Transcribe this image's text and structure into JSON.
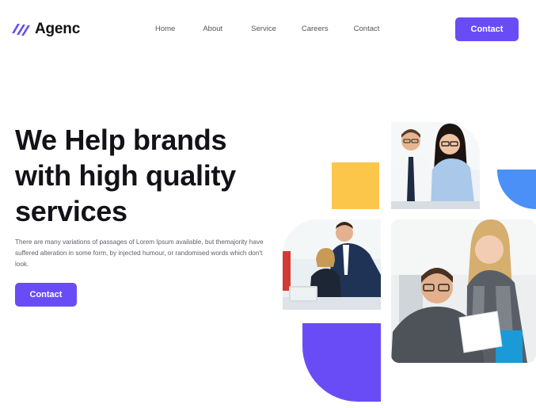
{
  "brand": {
    "name": "Agenc",
    "accent": "#6a4cf6"
  },
  "nav": {
    "items": [
      "Home",
      "About",
      "Service",
      "Careers",
      "Contact"
    ]
  },
  "header": {
    "cta_label": "Contact"
  },
  "hero": {
    "title": "We Help brands with high quality services",
    "description": "There are many variations of passages of Lorem Ipsum available, but themajority have suffered alteration in some form, by injected humour, or randomised words which don't look.",
    "cta_label": "Contact"
  },
  "colors": {
    "yellow": "#fcc64b",
    "blue": "#4a90f7",
    "purple": "#6a4cf6"
  },
  "images": [
    "team-photo-two-people",
    "team-photo-meeting",
    "team-photo-smiling-pair"
  ]
}
